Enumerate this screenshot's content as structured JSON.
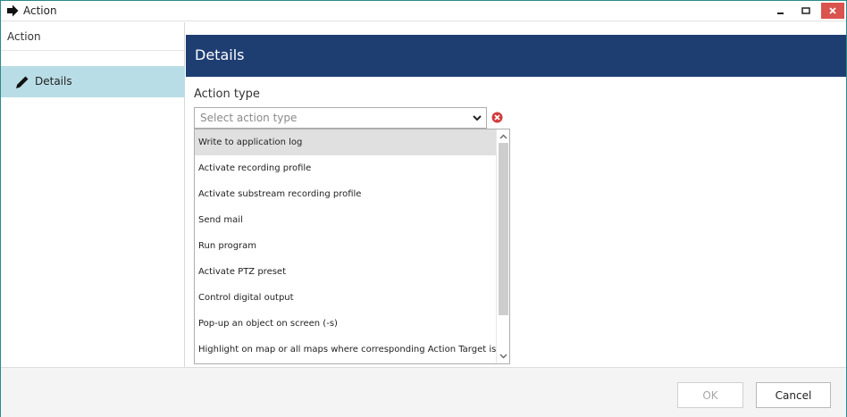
{
  "window": {
    "title": "Action",
    "icon": "arrow-right-icon",
    "controls": {
      "minimize": "minimize-icon",
      "maximize": "maximize-icon",
      "close": "close-icon"
    },
    "border_color": "#2a8a8a"
  },
  "sidebar": {
    "header": "Action",
    "items": [
      {
        "label": "Details",
        "icon": "pencil-icon",
        "selected": true
      }
    ],
    "selected_color": "#b9dde6"
  },
  "main": {
    "header_title": "Details",
    "header_color": "#1e3e72",
    "action_type": {
      "label": "Action type",
      "placeholder": "Select action type",
      "options": [
        "Write to application log",
        "Activate recording profile",
        "Activate substream recording profile",
        "Send mail",
        "Run program",
        "Activate PTZ preset",
        "Control digital output",
        "Pop-up an object on screen (-s)",
        "Highlight on map or all maps where corresponding Action Target is present."
      ],
      "highlighted_index": 0
    }
  },
  "footer": {
    "ok_label": "OK",
    "cancel_label": "Cancel"
  }
}
